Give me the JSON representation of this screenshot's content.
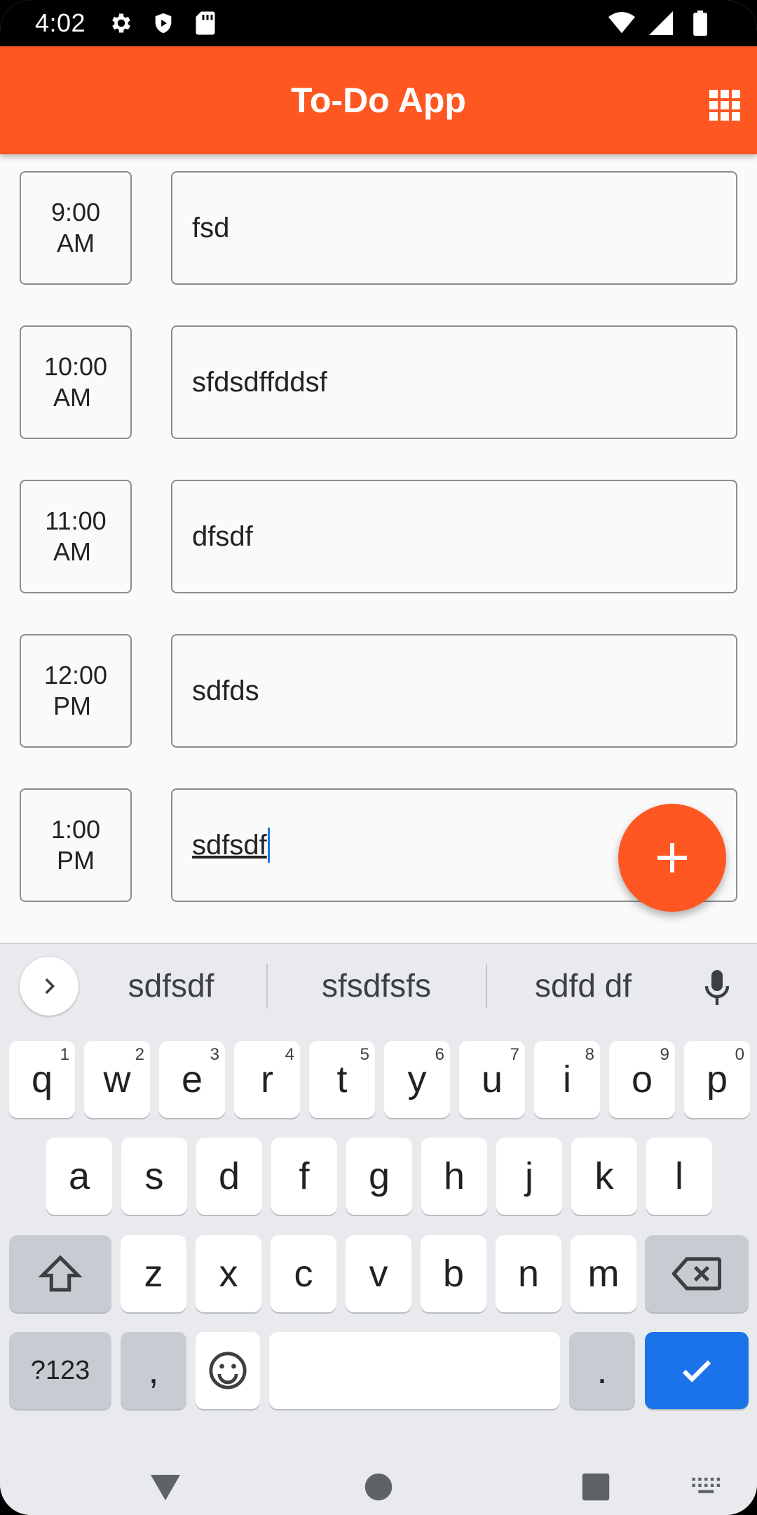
{
  "status_bar": {
    "time": "4:02",
    "left_icons": [
      "settings-icon",
      "play-protect-icon",
      "sd-card-icon"
    ],
    "right_icons": [
      "wifi-icon",
      "signal-icon",
      "battery-icon"
    ]
  },
  "app_bar": {
    "title": "To-Do App",
    "color": "#ff5722",
    "menu_icon": "grid-icon"
  },
  "todos": [
    {
      "time": "9:00",
      "period": "AM",
      "task": "fsd"
    },
    {
      "time": "10:00",
      "period": "AM",
      "task": "sfdsdffddsf"
    },
    {
      "time": "11:00",
      "period": "AM",
      "task": "dfsdf"
    },
    {
      "time": "12:00",
      "period": "PM",
      "task": "sdfds"
    },
    {
      "time": "1:00",
      "period": "PM",
      "task": "sdfsdf"
    }
  ],
  "fab": {
    "icon": "add-icon",
    "color": "#ff5722"
  },
  "keyboard": {
    "suggestions": [
      "sdfsdf",
      "sfsdfsfs",
      "sdfd df"
    ],
    "row1": [
      {
        "k": "q",
        "h": "1"
      },
      {
        "k": "w",
        "h": "2"
      },
      {
        "k": "e",
        "h": "3"
      },
      {
        "k": "r",
        "h": "4"
      },
      {
        "k": "t",
        "h": "5"
      },
      {
        "k": "y",
        "h": "6"
      },
      {
        "k": "u",
        "h": "7"
      },
      {
        "k": "i",
        "h": "8"
      },
      {
        "k": "o",
        "h": "9"
      },
      {
        "k": "p",
        "h": "0"
      }
    ],
    "row2": [
      "a",
      "s",
      "d",
      "f",
      "g",
      "h",
      "j",
      "k",
      "l"
    ],
    "row3": [
      "z",
      "x",
      "c",
      "v",
      "b",
      "n",
      "m"
    ],
    "symbols_label": "?123",
    "comma_label": ",",
    "period_label": ".",
    "accent_color": "#1a73e8"
  },
  "nav_bar": {
    "icons": [
      "back-icon",
      "home-icon",
      "recents-icon",
      "keyboard-switch-icon"
    ]
  }
}
